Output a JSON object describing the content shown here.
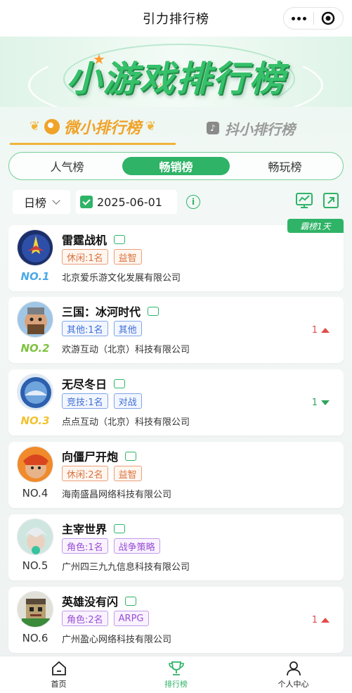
{
  "topbar": {
    "title": "引力排行榜"
  },
  "banner": {
    "title": "小游戏排行榜"
  },
  "category_tabs": [
    {
      "label": "微小排行榜",
      "active": true,
      "color": "#f0a328"
    },
    {
      "label": "抖小排行榜",
      "active": false
    }
  ],
  "subtabs": [
    {
      "label": "人气榜",
      "active": false
    },
    {
      "label": "畅销榜",
      "active": true
    },
    {
      "label": "畅玩榜",
      "active": false
    }
  ],
  "filter": {
    "period": "日榜",
    "date": "2025-06-01",
    "info_symbol": "i"
  },
  "badge": "霸榜1天",
  "games": [
    {
      "rank": "NO.1",
      "rank_style": "gold",
      "name": "雷霆战机",
      "tags": [
        {
          "text": "休闲:1名",
          "color": "orange"
        },
        {
          "text": "益智",
          "color": "orange"
        }
      ],
      "company": "北京爱乐游文化发展有限公司",
      "change": "",
      "direction": ""
    },
    {
      "rank": "NO.2",
      "rank_style": "silver",
      "name": "三国：冰河时代",
      "tags": [
        {
          "text": "其他:1名",
          "color": "blue"
        },
        {
          "text": "其他",
          "color": "blue"
        }
      ],
      "company": "欢游互动（北京）科技有限公司",
      "change": "1",
      "direction": "up"
    },
    {
      "rank": "NO.3",
      "rank_style": "bronze",
      "name": "无尽冬日",
      "tags": [
        {
          "text": "竞技:1名",
          "color": "blue"
        },
        {
          "text": "对战",
          "color": "blue"
        }
      ],
      "company": "点点互动（北京）科技有限公司",
      "change": "1",
      "direction": "down"
    },
    {
      "rank": "NO.4",
      "rank_style": "plain",
      "name": "向僵尸开炮",
      "tags": [
        {
          "text": "休闲:2名",
          "color": "orange"
        },
        {
          "text": "益智",
          "color": "orange"
        }
      ],
      "company": "海南盛昌网络科技有限公司",
      "change": "",
      "direction": ""
    },
    {
      "rank": "NO.5",
      "rank_style": "plain",
      "name": "主宰世界",
      "tags": [
        {
          "text": "角色:1名",
          "color": "purple"
        },
        {
          "text": "战争策略",
          "color": "purple"
        }
      ],
      "company": "广州四三九九信息科技有限公司",
      "change": "",
      "direction": ""
    },
    {
      "rank": "NO.6",
      "rank_style": "plain",
      "name": "英雄没有闪",
      "tags": [
        {
          "text": "角色:2名",
          "color": "purple"
        },
        {
          "text": "ARPG",
          "color": "purple"
        }
      ],
      "company": "广州盈心网络科技有限公司",
      "change": "1",
      "direction": "up"
    }
  ],
  "bottom_nav": [
    {
      "label": "首页",
      "icon": "home-icon",
      "active": false
    },
    {
      "label": "排行榜",
      "icon": "trophy-icon",
      "active": true
    },
    {
      "label": "个人中心",
      "icon": "user-icon",
      "active": false
    }
  ],
  "colors": {
    "accent": "#2fb367",
    "gold": "#f0a328",
    "up": "#e24b4b",
    "down": "#2fa35e"
  }
}
